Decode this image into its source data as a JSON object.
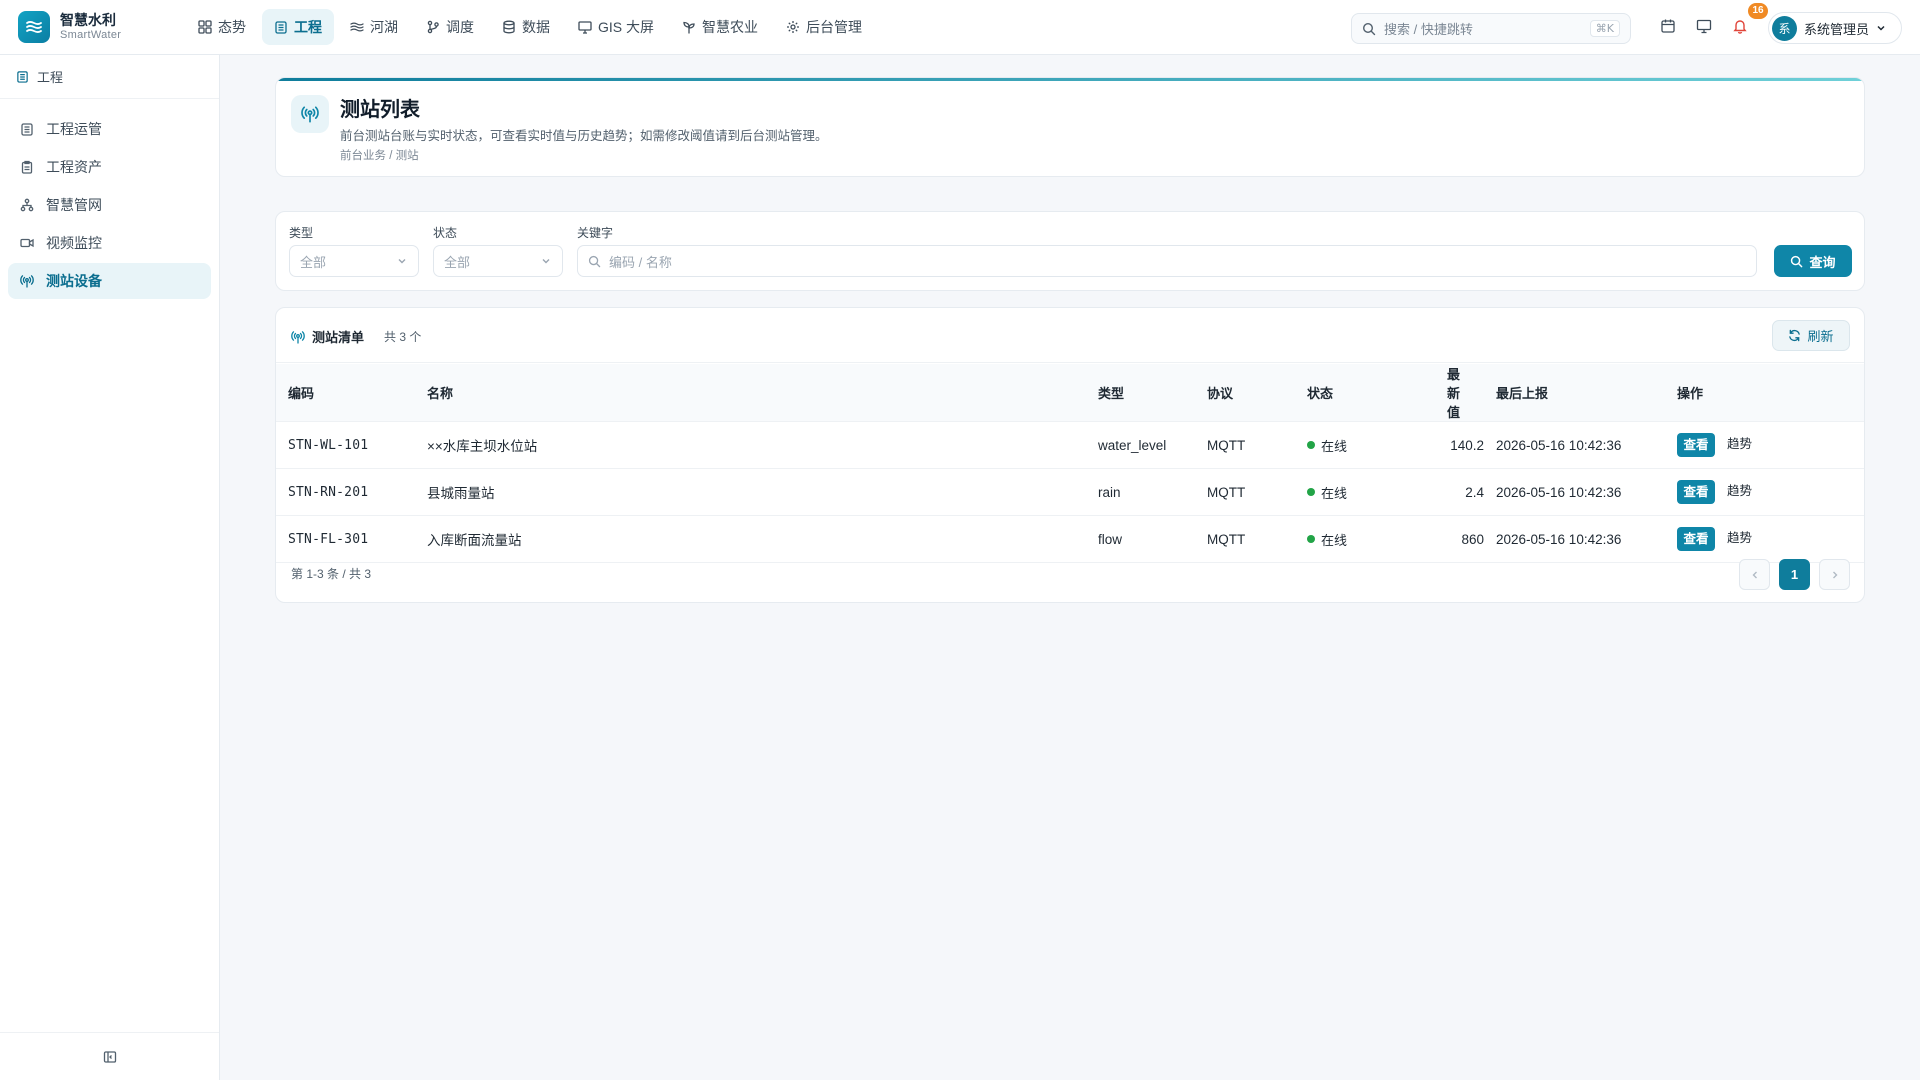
{
  "brand": {
    "name": "智慧水利",
    "sub": "SmartWater"
  },
  "nav": [
    {
      "label": "态势",
      "icon": "grid-icon"
    },
    {
      "label": "工程",
      "icon": "building-icon",
      "active": true
    },
    {
      "label": "河湖",
      "icon": "waves-icon"
    },
    {
      "label": "调度",
      "icon": "branch-icon"
    },
    {
      "label": "数据",
      "icon": "database-icon"
    },
    {
      "label": "GIS 大屏",
      "icon": "monitor-icon"
    },
    {
      "label": "智慧农业",
      "icon": "sprout-icon"
    },
    {
      "label": "后台管理",
      "icon": "gear-icon"
    }
  ],
  "search": {
    "placeholder": "搜索 / 快捷跳转",
    "shortcut": "⌘K"
  },
  "notifications": {
    "count": "16"
  },
  "user": {
    "avatar": "系",
    "name": "系统管理员"
  },
  "sidebar": {
    "section": "工程",
    "items": [
      {
        "label": "工程运管",
        "icon": "building-icon"
      },
      {
        "label": "工程资产",
        "icon": "clipboard-icon"
      },
      {
        "label": "智慧管网",
        "icon": "network-icon"
      },
      {
        "label": "视频监控",
        "icon": "video-icon"
      },
      {
        "label": "测站设备",
        "icon": "antenna-icon",
        "active": true
      }
    ]
  },
  "page": {
    "title": "测站列表",
    "description": "前台测站台账与实时状态，可查看实时值与历史趋势；如需修改阈值请到后台测站管理。",
    "breadcrumb": "前台业务 / 测站"
  },
  "filters": {
    "type_label": "类型",
    "type_value": "全部",
    "status_label": "状态",
    "status_value": "全部",
    "keyword_label": "关键字",
    "keyword_placeholder": "编码 / 名称",
    "query_label": "查询"
  },
  "table": {
    "title": "测站清单",
    "count": "共 3 个",
    "refresh_label": "刷新",
    "columns": [
      "编码",
      "名称",
      "类型",
      "协议",
      "状态",
      "最新值",
      "最后上报",
      "操作"
    ],
    "rows": [
      {
        "code": "STN-WL-101",
        "name": "××水库主坝水位站",
        "type": "water_level",
        "protocol": "MQTT",
        "status": "在线",
        "value": "140.2",
        "reported": "2026-05-16 10:42:36",
        "view": "查看",
        "trend": "趋势"
      },
      {
        "code": "STN-RN-201",
        "name": "县城雨量站",
        "type": "rain",
        "protocol": "MQTT",
        "status": "在线",
        "value": "2.4",
        "reported": "2026-05-16 10:42:36",
        "view": "查看",
        "trend": "趋势"
      },
      {
        "code": "STN-FL-301",
        "name": "入库断面流量站",
        "type": "flow",
        "protocol": "MQTT",
        "status": "在线",
        "value": "860",
        "reported": "2026-05-16 10:42:36",
        "view": "查看",
        "trend": "趋势"
      }
    ],
    "pager_info": "第 1-3 条 / 共 3",
    "current_page": "1"
  },
  "colors": {
    "accent": "#0f86a8",
    "online": "#22a447",
    "badge": "#f08a24"
  }
}
